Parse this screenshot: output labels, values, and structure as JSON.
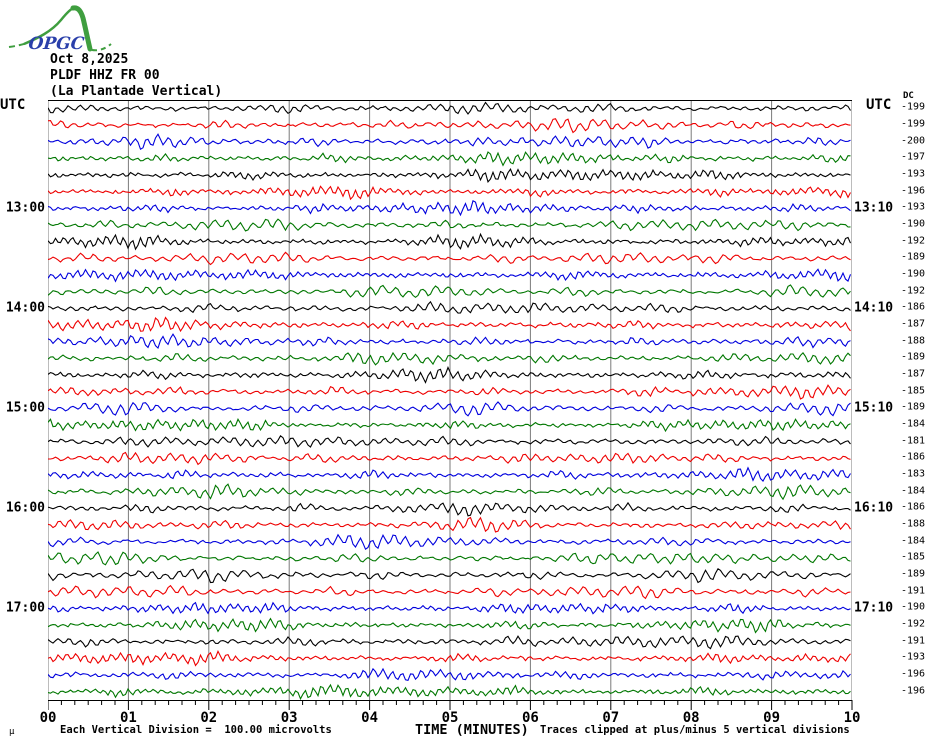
{
  "header": {
    "logo_text": "OPGC",
    "date": "Oct 8,2025",
    "station_code": "PLDF HHZ FR 00",
    "station_name": "(La Plantade Vertical)"
  },
  "left_axis": {
    "title": "UTC",
    "labels": [
      {
        "row": 7,
        "text": "13:00"
      },
      {
        "row": 13,
        "text": "14:00"
      },
      {
        "row": 19,
        "text": "15:00"
      },
      {
        "row": 25,
        "text": "16:00"
      },
      {
        "row": 31,
        "text": "17:00"
      }
    ]
  },
  "right_axis": {
    "title": "UTC",
    "dc_header": "DC",
    "labels": [
      {
        "row": 7,
        "text": "13:10"
      },
      {
        "row": 13,
        "text": "14:10"
      },
      {
        "row": 19,
        "text": "15:10"
      },
      {
        "row": 25,
        "text": "16:10"
      },
      {
        "row": 31,
        "text": "17:10"
      }
    ]
  },
  "x_axis": {
    "title": "TIME (MINUTES)",
    "ticks": [
      "00",
      "01",
      "02",
      "03",
      "04",
      "05",
      "06",
      "07",
      "08",
      "09",
      "10"
    ],
    "minor_ticks_per_major": 6
  },
  "footer": {
    "mark": "μ",
    "scale_note": "Each Vertical Division =  100.00 microvolts",
    "clip_note": "Traces clipped at plus/minus 5 vertical divisions"
  },
  "chart_data": {
    "type": "line",
    "subtype": "helicorder-seismogram",
    "title": "PLDF HHZ FR 00 (La Plantade Vertical) Oct 8,2025",
    "xlabel": "TIME (MINUTES)",
    "x_range_minutes": [
      0,
      10
    ],
    "rows": 36,
    "minutes_per_row": 10,
    "trace_color_cycle": [
      "#000000",
      "#ee0000",
      "#0000dd",
      "#007700"
    ],
    "grid_color": "#7a7a7a",
    "dc_offsets": [
      -199,
      -199,
      -200,
      -197,
      -193,
      -196,
      -193,
      -190,
      -192,
      -189,
      -190,
      -192,
      -186,
      -187,
      -188,
      -189,
      -187,
      -185,
      -189,
      -184,
      -181,
      -186,
      -183,
      -184,
      -186,
      -188,
      -184,
      -185,
      -189,
      -191,
      -190,
      -192,
      -191,
      -193,
      -196,
      -196
    ]
  }
}
